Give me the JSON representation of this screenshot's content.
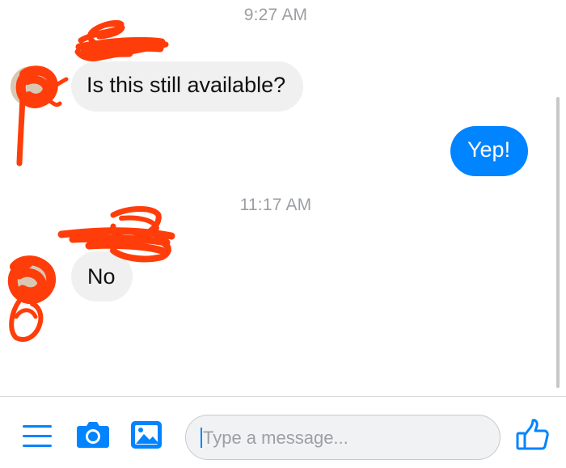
{
  "conversation": {
    "groups": [
      {
        "timestamp": "9:27 AM",
        "incoming": "Is this still available?",
        "outgoing": "Yep!"
      },
      {
        "timestamp": "11:17 AM",
        "incoming": "No"
      }
    ]
  },
  "composer": {
    "placeholder": "Type a message...",
    "icons": [
      "menu-icon",
      "camera-icon",
      "photo-icon",
      "like-icon"
    ]
  },
  "colors": {
    "accent": "#0084ff",
    "incoming_bubble": "#f0f0f0",
    "timestamp_text": "#9b9ea3",
    "redaction": "#ff3d0a"
  }
}
